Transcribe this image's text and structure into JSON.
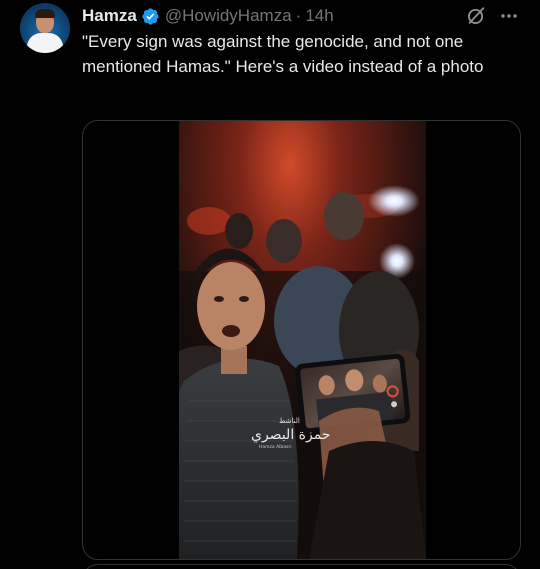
{
  "author": {
    "display_name": "Hamza",
    "handle": "@HowidyHamza",
    "separator": "·",
    "time": "14h",
    "verified_color": "#1d9bf0"
  },
  "tweet": {
    "text": "\"Every sign was against the genocide, and not one mentioned Hamas.\" Here's a video instead of a photo"
  },
  "icons": {
    "grok": "grok-icon",
    "more": "more-options-icon",
    "verified": "verified-badge-icon"
  },
  "media": {
    "type": "video",
    "watermark_arabic": "حمزة البصري",
    "watermark_small": "الناشط",
    "watermark_caption": "Hamza Albasri"
  },
  "colors": {
    "background": "#000000",
    "text_primary": "#e7e9ea",
    "text_secondary": "#71767b",
    "border": "#2f3336",
    "accent": "#1d9bf0"
  }
}
